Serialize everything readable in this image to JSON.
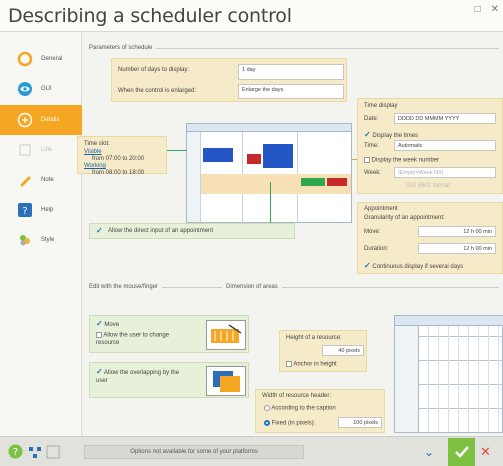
{
  "window": {
    "title": "Describing a scheduler control",
    "restore_glyph": "□",
    "close_glyph": "✕"
  },
  "sidebar": {
    "items": [
      {
        "label": "General",
        "icon": "orange-ring-icon"
      },
      {
        "label": "GUI",
        "icon": "eye-icon"
      },
      {
        "label": "Details",
        "icon": "details-icon",
        "active": true
      },
      {
        "label": "Link",
        "icon": "link-icon",
        "disabled": true
      },
      {
        "label": "Note",
        "icon": "pencil-icon"
      },
      {
        "label": "Help",
        "icon": "help-icon"
      },
      {
        "label": "Style",
        "icon": "style-icon"
      }
    ]
  },
  "params": {
    "section": "Parameters of schedule",
    "days_label": "Number of days to display:",
    "days_value": "1 day",
    "enlarged_label": "When the control is enlarged:",
    "enlarged_value": "Enlarge the days",
    "timeslot_label": "Time slot:",
    "visible_label": "Visible",
    "visible_value": "from 07:00 to 20:00",
    "working_label": "Working",
    "working_value": "from 08:00 to 18:00",
    "direct_input": "Allow the direct input of an appointment"
  },
  "time_display": {
    "title": "Time display",
    "date_label": "Date:",
    "date_value": "DDDD DD MMMM YYYY",
    "display_times": "Display the times",
    "time_label": "Time:",
    "time_value": "Automatic",
    "display_week": "Display the week number",
    "week_label": "Week:",
    "week_value": "(Empty=Week NX)",
    "iso": "ISO 8601 format"
  },
  "appointment": {
    "title": "Appointment",
    "granularity_label": "Granularity of an appointment:",
    "move_label": "Move:",
    "move_value": "12 h 00 min",
    "duration_label": "Duration:",
    "duration_value": "12 h 00 min",
    "continuous": "Continuous display if several days"
  },
  "edit": {
    "section": "Edit with the mouse/finger",
    "move": "Move",
    "allow_change": "Allow the user to change resource",
    "allow_overlap": "Allow the overlapping by the user"
  },
  "areas": {
    "section": "Dimension of areas",
    "height_label": "Height of a resource:",
    "height_value": "40 pixels",
    "anchor": "Anchor in height",
    "width_label": "Width of resource header:",
    "according": "According to the caption",
    "fixed": "Fixed (in pixels):",
    "fixed_value": "100 pixels"
  },
  "footer": {
    "note": "Options not available for some of your platforms"
  },
  "colors": {
    "accent": "#f5a623",
    "panel": "#f6ebc8",
    "green": "#e7f0d8",
    "check": "#1a73c9",
    "ok": "#7dc142",
    "cancel": "#e74c3c"
  }
}
